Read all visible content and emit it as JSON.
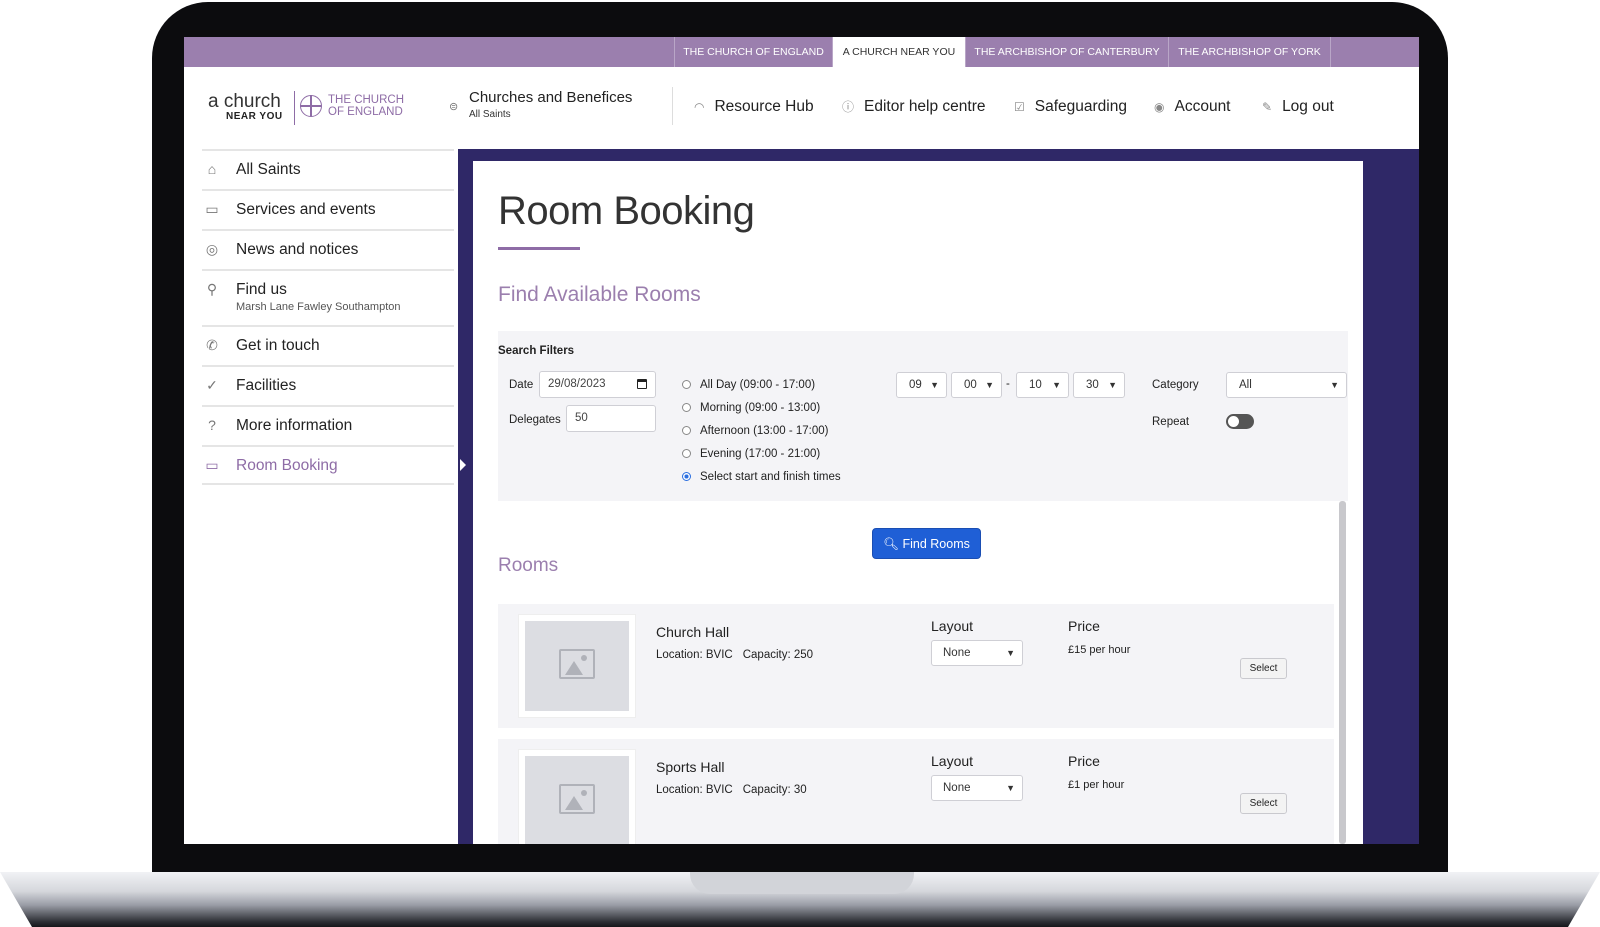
{
  "topbar": {
    "links": [
      {
        "label": "THE CHURCH OF ENGLAND"
      },
      {
        "label": "A CHURCH NEAR YOU"
      },
      {
        "label": "THE ARCHBISHOP OF CANTERBURY"
      },
      {
        "label": "THE ARCHBISHOP OF YORK"
      }
    ]
  },
  "logo": {
    "a_church": "a church",
    "near_you": "NEAR YOU",
    "coe_line1": "THE CHURCH",
    "coe_line2": "OF ENGLAND"
  },
  "header": {
    "churches_title": "Churches and Benefices",
    "churches_sub": "All Saints",
    "nav": [
      {
        "label": "Resource Hub",
        "icon": "rainbow-icon"
      },
      {
        "label": "Editor help centre",
        "icon": "question-icon"
      },
      {
        "label": "Safeguarding",
        "icon": "checkbox-icon"
      },
      {
        "label": "Account",
        "icon": "user-icon"
      },
      {
        "label": "Log out",
        "icon": "wrench-icon"
      }
    ]
  },
  "sidebar": {
    "items": [
      {
        "label": "All Saints",
        "icon": "home-icon"
      },
      {
        "label": "Services and events",
        "icon": "calendar-icon"
      },
      {
        "label": "News and notices",
        "icon": "broadcast-icon"
      },
      {
        "label": "Find us",
        "sub": "Marsh Lane Fawley Southampton",
        "icon": "pin-icon"
      },
      {
        "label": "Get in touch",
        "icon": "phone-icon"
      },
      {
        "label": "Facilities",
        "icon": "check-circle-icon"
      },
      {
        "label": "More information",
        "icon": "question-circle-icon"
      },
      {
        "label": "Room Booking",
        "icon": "calendar-icon"
      }
    ]
  },
  "main": {
    "title": "Room Booking",
    "find_heading": "Find Available Rooms",
    "filters_title": "Search Filters",
    "date_label": "Date",
    "date_value": "29/08/2023",
    "delegates_label": "Delegates",
    "delegates_value": "50",
    "time_options": [
      {
        "label": "All Day (09:00 - 17:00)",
        "selected": false
      },
      {
        "label": "Morning (09:00 - 13:00)",
        "selected": false
      },
      {
        "label": "Afternoon (13:00 - 17:00)",
        "selected": false
      },
      {
        "label": "Evening (17:00 - 21:00)",
        "selected": false
      },
      {
        "label": "Select start and finish times",
        "selected": true
      }
    ],
    "start_hour": "09",
    "start_min": "00",
    "time_dash": "-",
    "end_hour": "10",
    "end_min": "30",
    "category_label": "Category",
    "category_value": "All",
    "repeat_label": "Repeat",
    "repeat_on": false,
    "find_button": "Find Rooms",
    "rooms_heading": "Rooms",
    "layout_heading": "Layout",
    "price_heading": "Price",
    "select_label": "Select",
    "rooms": [
      {
        "name": "Church Hall",
        "location": "Location: BVIC",
        "capacity": "Capacity: 250",
        "layout": "None",
        "price": "£15 per hour"
      },
      {
        "name": "Sports Hall",
        "location": "Location: BVIC",
        "capacity": "Capacity: 30",
        "layout": "None",
        "price": "£1 per hour"
      }
    ]
  },
  "colors": {
    "accent": "#9b7fae",
    "main_bg": "#2f2867",
    "button": "#1f5fd6"
  }
}
